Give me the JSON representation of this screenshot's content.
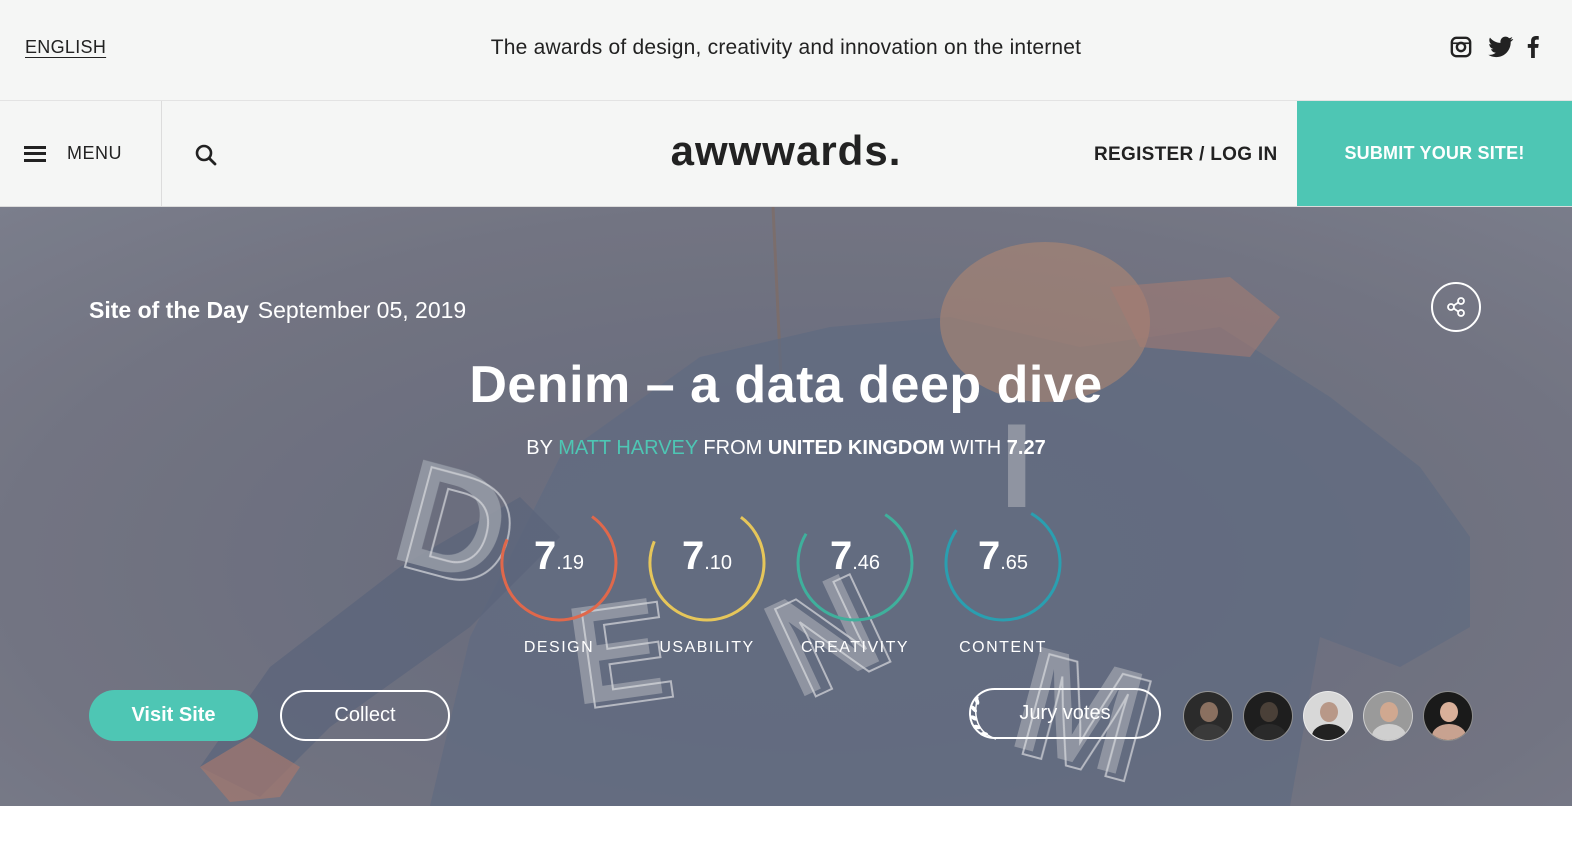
{
  "topbar": {
    "language": "ENGLISH",
    "tagline": "The awards of design, creativity and innovation on the internet",
    "socials": [
      "instagram-icon",
      "twitter-icon",
      "facebook-icon"
    ]
  },
  "nav": {
    "menu_label": "MENU",
    "logo": "awwwards.",
    "login_label": "REGISTER / LOG IN",
    "submit_label": "SUBMIT YOUR SITE!"
  },
  "hero": {
    "badge": "Site of the Day",
    "date": "September 05, 2019",
    "title": "Denim – a data deep dive",
    "by_prefix": "BY",
    "author": "MATT HARVEY",
    "from_prefix": "FROM",
    "country": "UNITED KINGDOM",
    "with_prefix": "WITH",
    "overall": "7.27",
    "scores": [
      {
        "label": "DESIGN",
        "whole": "7",
        "decimal": ".19",
        "value": 7.19,
        "color": "#e0684b"
      },
      {
        "label": "USABILITY",
        "whole": "7",
        "decimal": ".10",
        "value": 7.1,
        "color": "#e6c65a"
      },
      {
        "label": "CREATIVITY",
        "whole": "7",
        "decimal": ".46",
        "value": 7.46,
        "color": "#3fb09c"
      },
      {
        "label": "CONTENT",
        "whole": "7",
        "decimal": ".65",
        "value": 7.65,
        "color": "#2a9fb0"
      }
    ],
    "visit_label": "Visit Site",
    "collect_label": "Collect",
    "jury_label": "Jury votes",
    "accent": "#4ec6b4"
  }
}
